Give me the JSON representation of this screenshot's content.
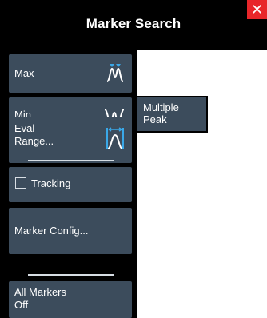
{
  "dialog": {
    "title": "Marker Search",
    "close_label": "✕"
  },
  "menu": {
    "max_label": "Max",
    "min_label": "Min",
    "eval_range_label_line1": "Eval",
    "eval_range_label_line2": "Range...",
    "tracking_label": "Tracking",
    "tracking_checked": false,
    "marker_config_label": "Marker Config...",
    "all_markers_off_line1": "All Markers",
    "all_markers_off_line2": "Off"
  },
  "submenu": {
    "line1": "Multiple",
    "line2": "Peak"
  },
  "icons": {
    "max": "max-peak-icon",
    "min": "min-peak-icon",
    "eval_range": "eval-range-icon"
  },
  "colors": {
    "button_bg": "#3c4c5c",
    "icon_line": "#ffffff",
    "icon_accent": "#3aa8e8",
    "close_bg": "#e8262a"
  }
}
